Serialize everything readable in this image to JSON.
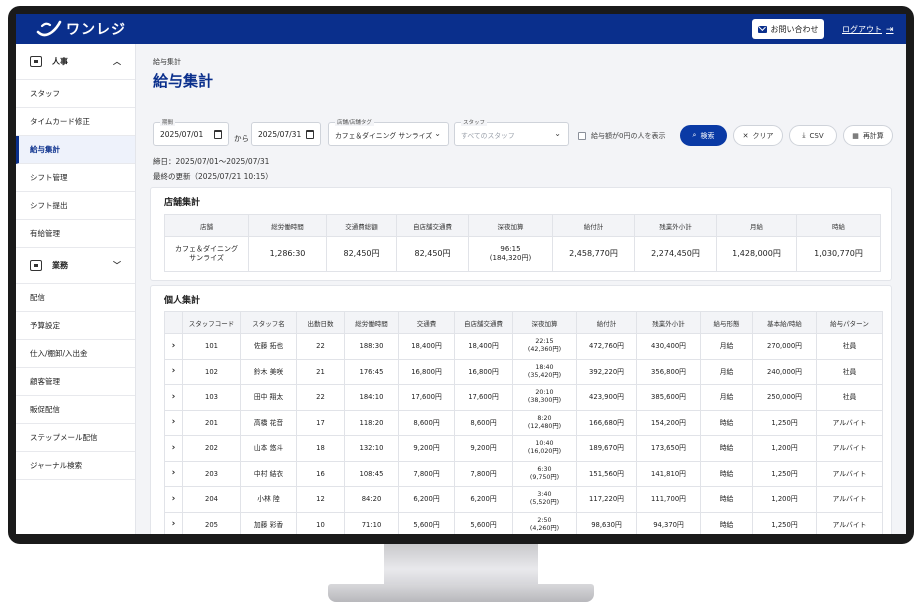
{
  "header": {
    "logo_text": "ワンレジ",
    "contact_label": "お問い合わせ",
    "logout_label": "ログアウト"
  },
  "sidebar": {
    "groups": [
      {
        "label": "人事",
        "items": [
          "スタッフ",
          "タイムカード修正",
          "給与集計",
          "シフト管理",
          "シフト提出",
          "有給管理"
        ]
      },
      {
        "label": "業務",
        "items": [
          "配信",
          "予算設定",
          "仕入/棚卸/入出金",
          "顧客管理",
          "販促配信",
          "ステップメール配信",
          "ジャーナル検索"
        ]
      }
    ],
    "active_item": "給与集計"
  },
  "page": {
    "breadcrumb": "給与集計",
    "title": "給与集計"
  },
  "filters": {
    "period_label": "期間",
    "start_date": "2025/07/01",
    "kara": "から",
    "end_date": "2025/07/31",
    "store_label": "店舗/店舗タグ",
    "store_value": "カフェ＆ダイニング サンライズ",
    "staff_label": "スタッフ",
    "staff_placeholder": "すべてのスタッフ",
    "zero_checkbox_label": "給与額が0円の人を表示",
    "search_label": "検索",
    "clear_label": "クリア",
    "csv_label": "CSV",
    "recalc_label": "再計算"
  },
  "meta": {
    "closing": "締日：2025/07/01〜2025/07/31",
    "updated": "最終の更新（2025/07/21 10:15）"
  },
  "store_summary": {
    "title": "店舗集計",
    "headers": [
      "店舗",
      "総労働時間",
      "交通費総額",
      "自店舗交通費",
      "深夜加算",
      "給付計",
      "残業外小計",
      "月給",
      "時給"
    ],
    "row": {
      "store": "カフェ＆ダイニング\nサンライズ",
      "total_hours": "1,286:30",
      "transport_total": "82,450円",
      "own_transport": "82,450円",
      "night": "96:15\n(184,320円)",
      "pay_total": "2,458,770円",
      "overtime_subtotal": "2,274,450円",
      "monthly": "1,428,000円",
      "hourly": "1,030,770円"
    }
  },
  "staff_summary": {
    "title": "個人集計",
    "headers": [
      "",
      "スタッフコード",
      "スタッフ名",
      "出勤日数",
      "総労働時間",
      "交通費",
      "自店舗交通費",
      "深夜加算",
      "給付計",
      "残業外小計",
      "給与形態",
      "基本給/時給",
      "給与パターン"
    ],
    "rows": [
      {
        "code": "101",
        "name": "佐藤 拓也",
        "days": "22",
        "hours": "188:30",
        "transport": "18,400円",
        "own": "18,400円",
        "night": "22:15\n(42,360円)",
        "pay": "472,760円",
        "ot": "430,400円",
        "type": "月給",
        "base": "270,000円",
        "pattern": "社員"
      },
      {
        "code": "102",
        "name": "鈴木 美咲",
        "days": "21",
        "hours": "176:45",
        "transport": "16,800円",
        "own": "16,800円",
        "night": "18:40\n(35,420円)",
        "pay": "392,220円",
        "ot": "356,800円",
        "type": "月給",
        "base": "240,000円",
        "pattern": "社員"
      },
      {
        "code": "103",
        "name": "田中 翔太",
        "days": "22",
        "hours": "184:10",
        "transport": "17,600円",
        "own": "17,600円",
        "night": "20:10\n(38,300円)",
        "pay": "423,900円",
        "ot": "385,600円",
        "type": "月給",
        "base": "250,000円",
        "pattern": "社員"
      },
      {
        "code": "201",
        "name": "高橋 花音",
        "days": "17",
        "hours": "118:20",
        "transport": "8,600円",
        "own": "8,600円",
        "night": "8:20\n(12,480円)",
        "pay": "166,680円",
        "ot": "154,200円",
        "type": "時給",
        "base": "1,250円",
        "pattern": "アルバイト"
      },
      {
        "code": "202",
        "name": "山本 悠斗",
        "days": "18",
        "hours": "132:10",
        "transport": "9,200円",
        "own": "9,200円",
        "night": "10:40\n(16,020円)",
        "pay": "189,670円",
        "ot": "173,650円",
        "type": "時給",
        "base": "1,200円",
        "pattern": "アルバイト"
      },
      {
        "code": "203",
        "name": "中村 結衣",
        "days": "16",
        "hours": "108:45",
        "transport": "7,800円",
        "own": "7,800円",
        "night": "6:30\n(9,750円)",
        "pay": "151,560円",
        "ot": "141,810円",
        "type": "時給",
        "base": "1,250円",
        "pattern": "アルバイト"
      },
      {
        "code": "204",
        "name": "小林 陸",
        "days": "12",
        "hours": "84:20",
        "transport": "6,200円",
        "own": "6,200円",
        "night": "3:40\n(5,520円)",
        "pay": "117,220円",
        "ot": "111,700円",
        "type": "時給",
        "base": "1,200円",
        "pattern": "アルバイト"
      },
      {
        "code": "205",
        "name": "加藤 彩香",
        "days": "10",
        "hours": "71:10",
        "transport": "5,600円",
        "own": "5,600円",
        "night": "2:50\n(4,260円)",
        "pay": "98,630円",
        "ot": "94,370円",
        "type": "時給",
        "base": "1,250円",
        "pattern": "アルバイト"
      }
    ]
  },
  "colors": {
    "brand": "#0a2f8c",
    "primary_button": "#0a3aa5"
  },
  "icons": {
    "row_expand": "chevron-right-icon",
    "calendar": "calendar-icon",
    "dropdown": "chevron-down-icon"
  }
}
